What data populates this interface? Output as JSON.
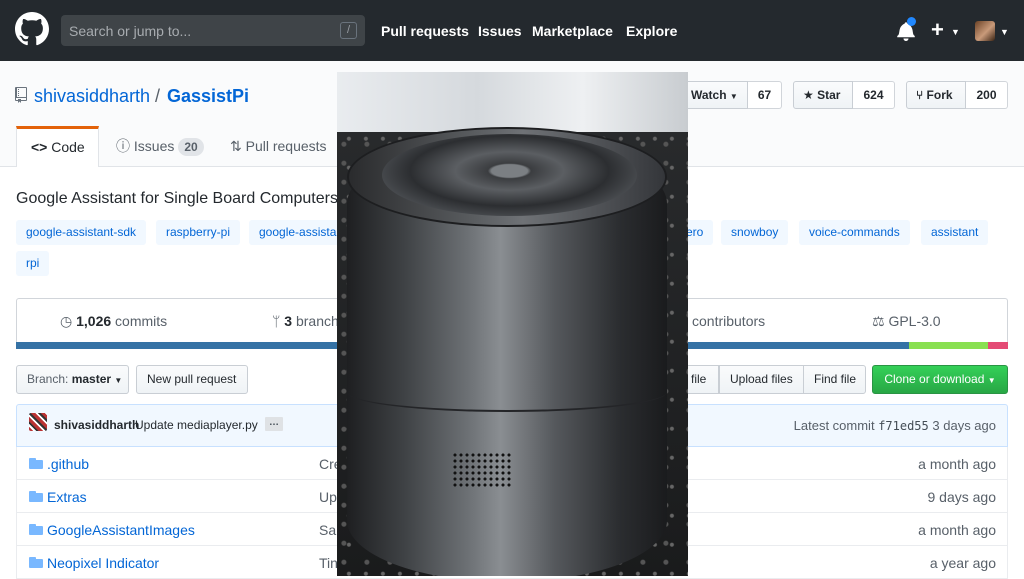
{
  "header": {
    "search_placeholder": "Search or jump to...",
    "search_key": "/",
    "nav": [
      "Pull requests",
      "Issues",
      "Marketplace",
      "Explore"
    ]
  },
  "repo": {
    "owner": "shivasiddharth",
    "separator": "/",
    "name": "GassistPi",
    "watch_label": "Watch",
    "watch_count": "67",
    "star_label": "Star",
    "star_count": "624",
    "fork_label": "Fork",
    "fork_count": "200"
  },
  "tabs": {
    "code": "Code",
    "issues": "Issues",
    "issues_count": "20",
    "pulls": "Pull requests"
  },
  "description": "Google Assistant for Single Board Computers",
  "topics": [
    "google-assistant-sdk",
    "raspberry-pi",
    "google-assistan",
    "ero",
    "snowboy",
    "voice-commands",
    "assistant",
    "rpi"
  ],
  "numbers": {
    "commits_count": "1,026",
    "commits_label": "commits",
    "branches_count": "3",
    "branches_label": "branch",
    "contributors_label": "contributors",
    "license": "GPL-3.0"
  },
  "language_colors": [
    "#3572a5",
    "#89e051",
    "#e44b75"
  ],
  "language_shares": [
    0.9,
    0.08,
    0.02
  ],
  "file_nav": {
    "branch_prefix": "Branch:",
    "branch": "master",
    "new_pr": "New pull request",
    "find_file_partial": "file",
    "upload": "Upload files",
    "find": "Find file",
    "clone": "Clone or download"
  },
  "commit": {
    "author": "shivasiddharth",
    "message": "Update mediaplayer.py",
    "ellipsis": "…",
    "latest_label": "Latest commit",
    "sha": "f71ed55",
    "age": "3 days ago"
  },
  "files": [
    {
      "name": ".github",
      "message": "Cre",
      "age": "a month ago"
    },
    {
      "name": "Extras",
      "message": "Up",
      "age": "9 days ago"
    },
    {
      "name": "GoogleAssistantImages",
      "message": "Sar",
      "age": "a month ago"
    },
    {
      "name": "Neopixel Indicator",
      "message": "Tin",
      "age": "a year ago"
    }
  ]
}
